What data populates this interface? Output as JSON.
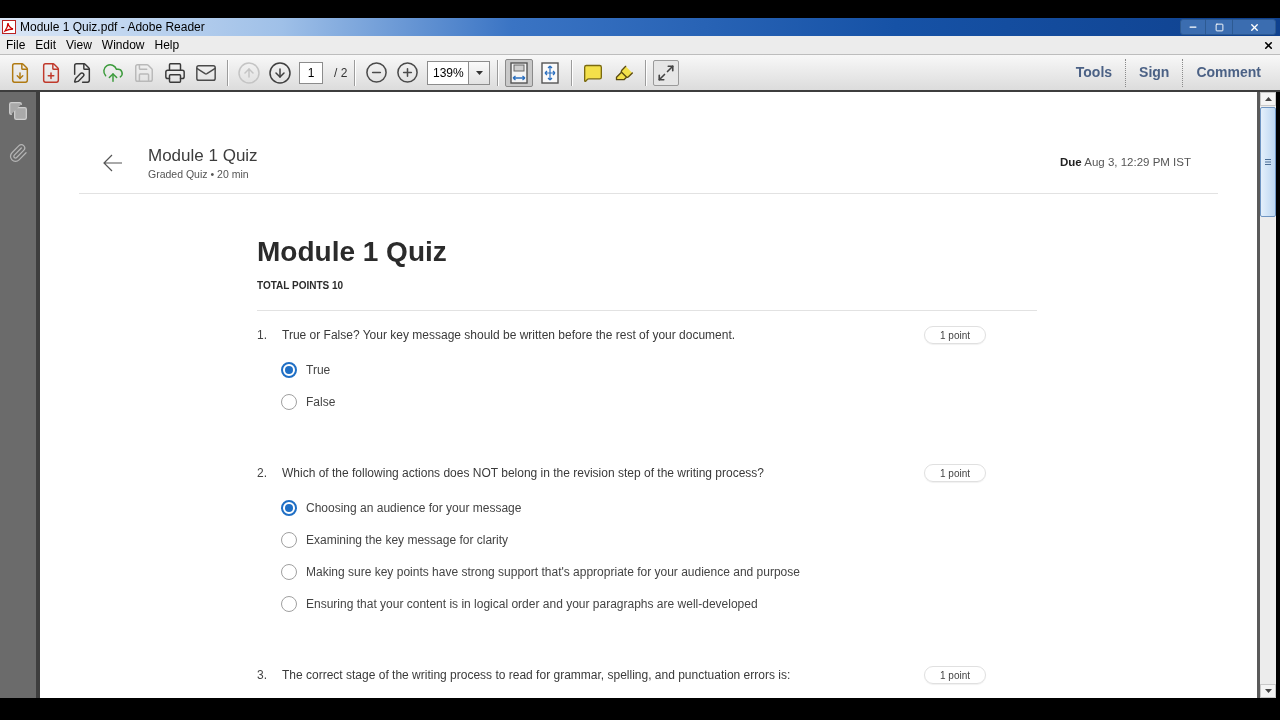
{
  "window": {
    "title": "Module 1 Quiz.pdf - Adobe Reader"
  },
  "menu": [
    "File",
    "Edit",
    "View",
    "Window",
    "Help"
  ],
  "toolbar": {
    "file_buttons": [
      {
        "kind": "open",
        "disabled": false
      },
      {
        "kind": "create",
        "disabled": false
      },
      {
        "kind": "edit",
        "disabled": false
      },
      {
        "kind": "upload",
        "disabled": false
      },
      {
        "kind": "save",
        "disabled": true
      },
      {
        "kind": "print",
        "disabled": false
      },
      {
        "kind": "email",
        "disabled": false
      }
    ],
    "nav_buttons": [
      {
        "kind": "previous",
        "disabled": true
      },
      {
        "kind": "next",
        "disabled": false
      }
    ],
    "page_number": "1",
    "page_count": "/ 2",
    "zoom": "139%",
    "view_modes": [
      {
        "kind": "fit-page",
        "selected": true
      },
      {
        "kind": "fit-width",
        "selected": false
      }
    ],
    "panes": [
      "Tools",
      "Sign",
      "Comment"
    ]
  },
  "document": {
    "header": {
      "title": "Module 1 Quiz",
      "subtitle": "Graded Quiz • 20 min",
      "due": "**Due** Aug 3, 12:29 PM IST"
    },
    "quiz": {
      "title": "Module 1 Quiz",
      "total_points": "TOTAL POINTS 10",
      "questions": [
        {
          "number": "1.",
          "text": "True or False? Your key message should be written before the rest of your document.",
          "points": "1 point",
          "options": [
            {
              "label": "True",
              "selected": true
            },
            {
              "label": "False",
              "selected": false
            }
          ]
        },
        {
          "number": "2.",
          "text": "Which of the following actions does NOT belong in the revision step of the writing process?",
          "points": "1 point",
          "options": [
            {
              "label": "Choosing an audience for your message",
              "selected": true
            },
            {
              "label": "Examining the key message for clarity",
              "selected": false
            },
            {
              "label": "Making sure key points have strong support that's appropriate for your audience and purpose",
              "selected": false
            },
            {
              "label": "Ensuring that your content is in logical order and your paragraphs are well-developed",
              "selected": false
            }
          ]
        },
        {
          "number": "3.",
          "text": "The correct stage of the writing process to read for grammar, spelling, and punctuation errors is:",
          "points": "1 point"
        }
      ]
    }
  }
}
